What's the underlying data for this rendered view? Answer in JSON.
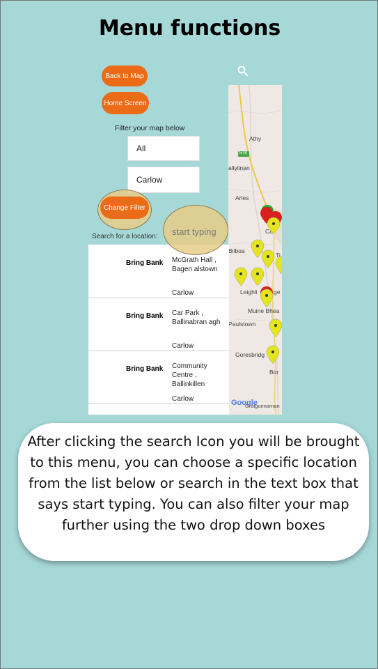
{
  "page": {
    "title": "Menu functions"
  },
  "menu": {
    "back_to_map": "Back to Map",
    "home_screen": "Home Screen",
    "filter_label": "Filter your map below",
    "filter_all": "All",
    "filter_county": "Carlow",
    "change_filter": "Change Filter",
    "search_label": "Search for a location:",
    "search_placeholder": "start typing"
  },
  "results": [
    {
      "name": "Bring Bank",
      "address": "McGrath Hall , Bagen alstown",
      "county": "Carlow"
    },
    {
      "name": "Bring Bank",
      "address": "Car Park , Ballinabran agh",
      "county": "Carlow"
    },
    {
      "name": "Bring Bank",
      "address": "Community Centre , Ballinkillen",
      "county": "Carlow"
    }
  ],
  "map": {
    "places": [
      "Athy",
      "allylinan",
      "Arles",
      "Ca",
      "Bilboa",
      "Ti",
      "Leighli",
      "ge",
      "Muine Bhea",
      "Paulstown",
      "Goresbridg",
      "Bor",
      "Goresbridge"
    ],
    "road": "N78",
    "logo": "Google",
    "logo_extra": "Graiguenaman"
  },
  "caption": "After clicking the search Icon you will be brought to this menu, you can choose a specific location from the list below or search in the text box that says start typing. You can also filter your map further using the two drop down boxes",
  "colors": {
    "background": "#a6d8d8",
    "accent": "#ec6b16",
    "marker": "#e4e51c"
  },
  "icons": {
    "search": "search-icon",
    "marker": "map-marker-icon"
  }
}
